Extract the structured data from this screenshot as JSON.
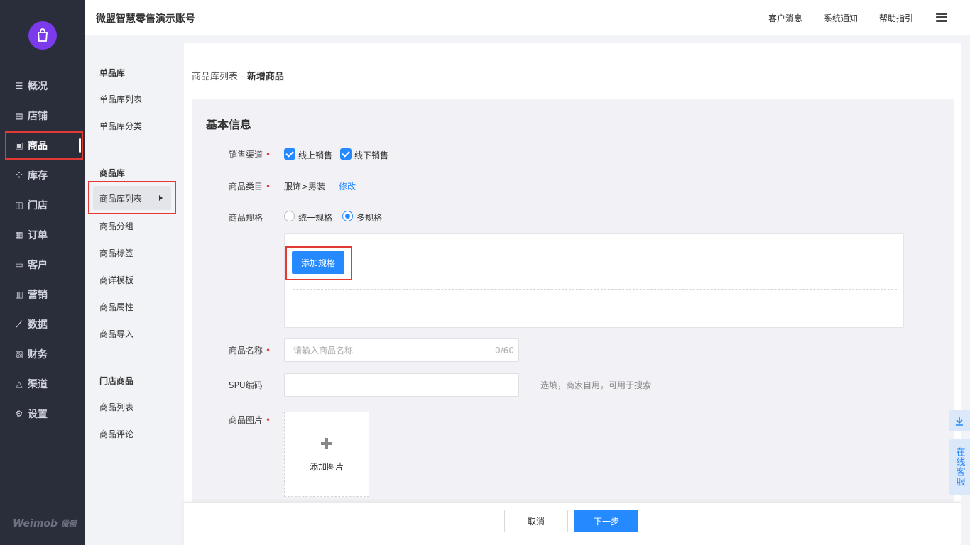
{
  "header": {
    "title": "微盟智慧零售演示账号",
    "links": [
      "客户消息",
      "系统通知",
      "帮助指引"
    ]
  },
  "nav": {
    "items": [
      {
        "label": "概况",
        "icon": "overview-icon"
      },
      {
        "label": "店铺",
        "icon": "store-icon"
      },
      {
        "label": "商品",
        "icon": "product-icon",
        "active": true
      },
      {
        "label": "库存",
        "icon": "inventory-icon"
      },
      {
        "label": "门店",
        "icon": "shop-icon"
      },
      {
        "label": "订单",
        "icon": "order-icon"
      },
      {
        "label": "客户",
        "icon": "customer-icon"
      },
      {
        "label": "营销",
        "icon": "marketing-icon"
      },
      {
        "label": "数据",
        "icon": "data-icon"
      },
      {
        "label": "财务",
        "icon": "finance-icon"
      },
      {
        "label": "渠道",
        "icon": "channel-icon"
      },
      {
        "label": "设置",
        "icon": "settings-icon"
      }
    ],
    "brand": "Weimob",
    "brand_cn": "微盟"
  },
  "submenu": {
    "group1_title": "单品库",
    "group1_items": [
      "单品库列表",
      "单品库分类"
    ],
    "group2_title": "商品库",
    "group2_items": [
      "商品库列表",
      "商品分组",
      "商品标签",
      "商详模板",
      "商品属性",
      "商品导入"
    ],
    "group3_title": "门店商品",
    "group3_items": [
      "商品列表",
      "商品评论"
    ]
  },
  "breadcrumb": {
    "parent": "商品库列表 -",
    "current": "新增商品"
  },
  "form": {
    "section_title": "基本信息",
    "sales_channel": {
      "label": "销售渠道",
      "options": [
        "线上销售",
        "线下销售"
      ]
    },
    "category": {
      "label": "商品类目",
      "value": "服饰>男装",
      "edit_link": "修改"
    },
    "spec": {
      "label": "商品规格",
      "options": [
        "统一规格",
        "多规格"
      ],
      "selected": "多规格",
      "add_button": "添加规格"
    },
    "name": {
      "label": "商品名称",
      "placeholder": "请输入商品名称",
      "counter": "0/60"
    },
    "spu": {
      "label": "SPU编码",
      "hint": "选填，商家自用，可用于搜索"
    },
    "images": {
      "label": "商品图片",
      "upload_text": "添加图片"
    }
  },
  "footer": {
    "cancel": "取消",
    "next": "下一步"
  },
  "float": {
    "service": "在线客服"
  },
  "colors": {
    "nav_bg": "#2a2e3b",
    "primary": "#2589ff",
    "required": "#e53935",
    "annotation": "#e53935"
  }
}
